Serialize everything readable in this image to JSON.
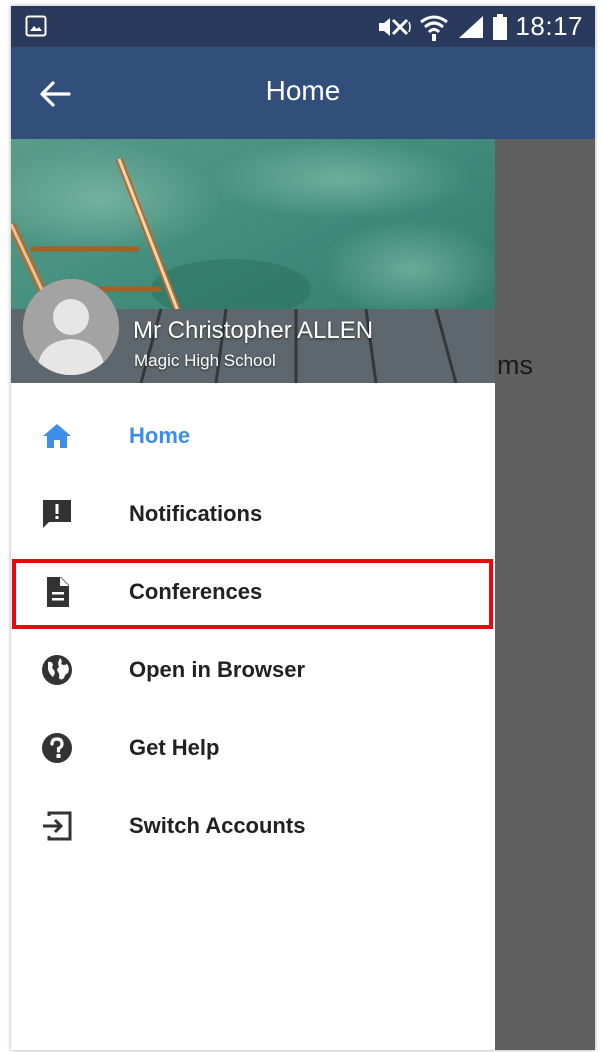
{
  "status_bar": {
    "time": "18:17",
    "icons": [
      "image-icon",
      "mute-icon",
      "wifi-icon",
      "signal-icon",
      "battery-icon"
    ]
  },
  "app_bar": {
    "title": "Home",
    "back_icon": "arrow-left-icon"
  },
  "background": {
    "partial_text": "ms"
  },
  "drawer": {
    "user_name": "Mr Christopher ALLEN",
    "school": "Magic High School",
    "items": [
      {
        "label": "Home",
        "icon": "home-icon",
        "active": true
      },
      {
        "label": "Notifications",
        "icon": "alert-icon",
        "active": false
      },
      {
        "label": "Conferences",
        "icon": "document-icon",
        "active": false,
        "highlighted": true
      },
      {
        "label": "Open in Browser",
        "icon": "globe-icon",
        "active": false
      },
      {
        "label": "Get Help",
        "icon": "help-icon",
        "active": false
      },
      {
        "label": "Switch Accounts",
        "icon": "switch-account-icon",
        "active": false
      }
    ]
  },
  "colors": {
    "status_bar": "#2a3a5c",
    "app_bar": "#324e7b",
    "active_item": "#3d8ee8",
    "highlight": "#e8090d",
    "scrim": "#5f5f5f"
  }
}
